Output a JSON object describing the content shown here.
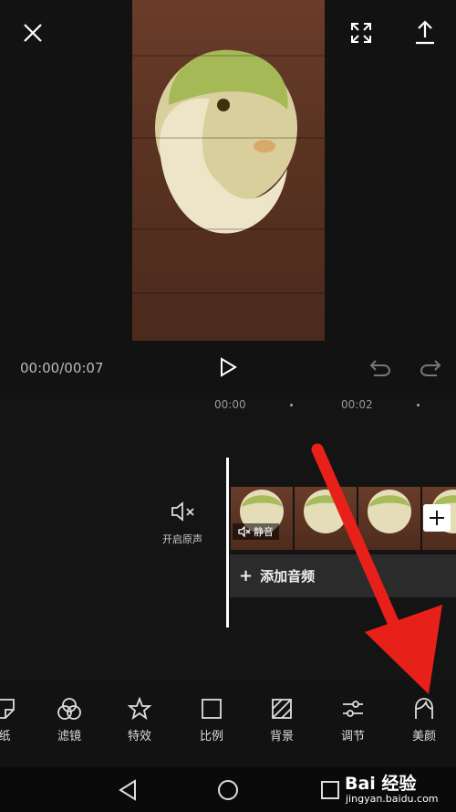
{
  "header": {
    "close_icon": "close-icon",
    "fullscreen_icon": "fullscreen-icon",
    "export_icon": "export-icon"
  },
  "player": {
    "time": "00:00/00:07",
    "play_icon": "play-icon",
    "undo_icon": "undo-icon",
    "redo_icon": "redo-icon"
  },
  "ruler": {
    "marks": [
      "00:00",
      "00:02"
    ]
  },
  "track": {
    "mute_label": "开启原声",
    "clip_mute_label": "静音",
    "add_clip_icon": "plus-icon",
    "add_audio_label": "添加音频"
  },
  "toolbar": {
    "items": [
      {
        "label": "纸",
        "icon": "sticker-icon"
      },
      {
        "label": "滤镜",
        "icon": "filter-icon"
      },
      {
        "label": "特效",
        "icon": "effects-icon"
      },
      {
        "label": "比例",
        "icon": "ratio-icon"
      },
      {
        "label": "背景",
        "icon": "background-icon"
      },
      {
        "label": "调节",
        "icon": "adjust-icon"
      },
      {
        "label": "美颜",
        "icon": "beauty-icon"
      }
    ]
  },
  "annotation": {
    "arrow_color": "#e8201a"
  },
  "watermark": {
    "brand": "Bai 经验",
    "url": "jingyan.baidu.com"
  },
  "colors": {
    "background": "#121212",
    "accent": "#ffffff"
  }
}
